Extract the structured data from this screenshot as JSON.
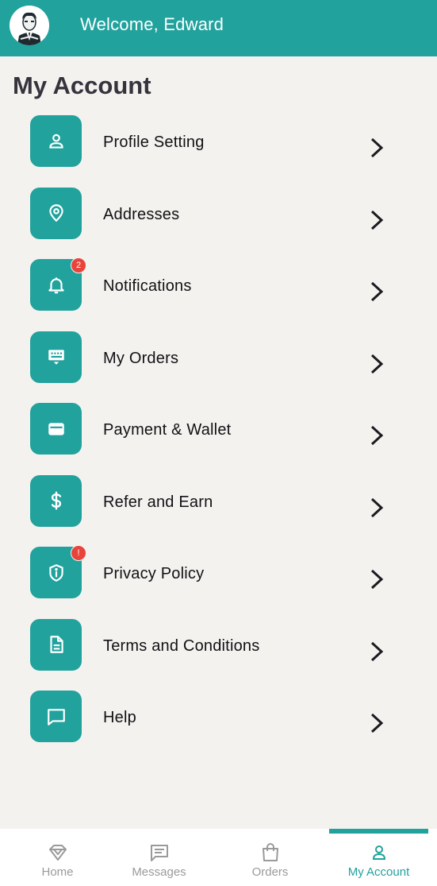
{
  "header": {
    "welcome_text": "Welcome, Edward",
    "avatar_icon": "businessman-avatar"
  },
  "page": {
    "title": "My Account"
  },
  "menu": {
    "items": [
      {
        "label": "Profile Setting",
        "icon": "user-icon"
      },
      {
        "label": "Addresses",
        "icon": "location-pin-icon"
      },
      {
        "label": "Notifications",
        "icon": "bell-icon",
        "badge": "2"
      },
      {
        "label": "My Orders",
        "icon": "orders-icon"
      },
      {
        "label": "Payment & Wallet",
        "icon": "wallet-icon"
      },
      {
        "label": "Refer and Earn",
        "icon": "dollar-icon"
      },
      {
        "label": "Privacy Policy",
        "icon": "shield-icon",
        "badge": "!"
      },
      {
        "label": "Terms and Conditions",
        "icon": "document-icon"
      },
      {
        "label": "Help",
        "icon": "chat-icon"
      }
    ]
  },
  "bottom_nav": {
    "tabs": [
      {
        "label": "Home",
        "icon": "diamond-icon"
      },
      {
        "label": "Messages",
        "icon": "message-icon"
      },
      {
        "label": "Orders",
        "icon": "shopping-bag-icon"
      },
      {
        "label": "My Account",
        "icon": "user-icon",
        "active": true
      }
    ]
  },
  "colors": {
    "accent": "#21a29d",
    "background": "#f4f2ef",
    "badge": "#e8443b",
    "inactive_nav": "#9a9a9a"
  }
}
